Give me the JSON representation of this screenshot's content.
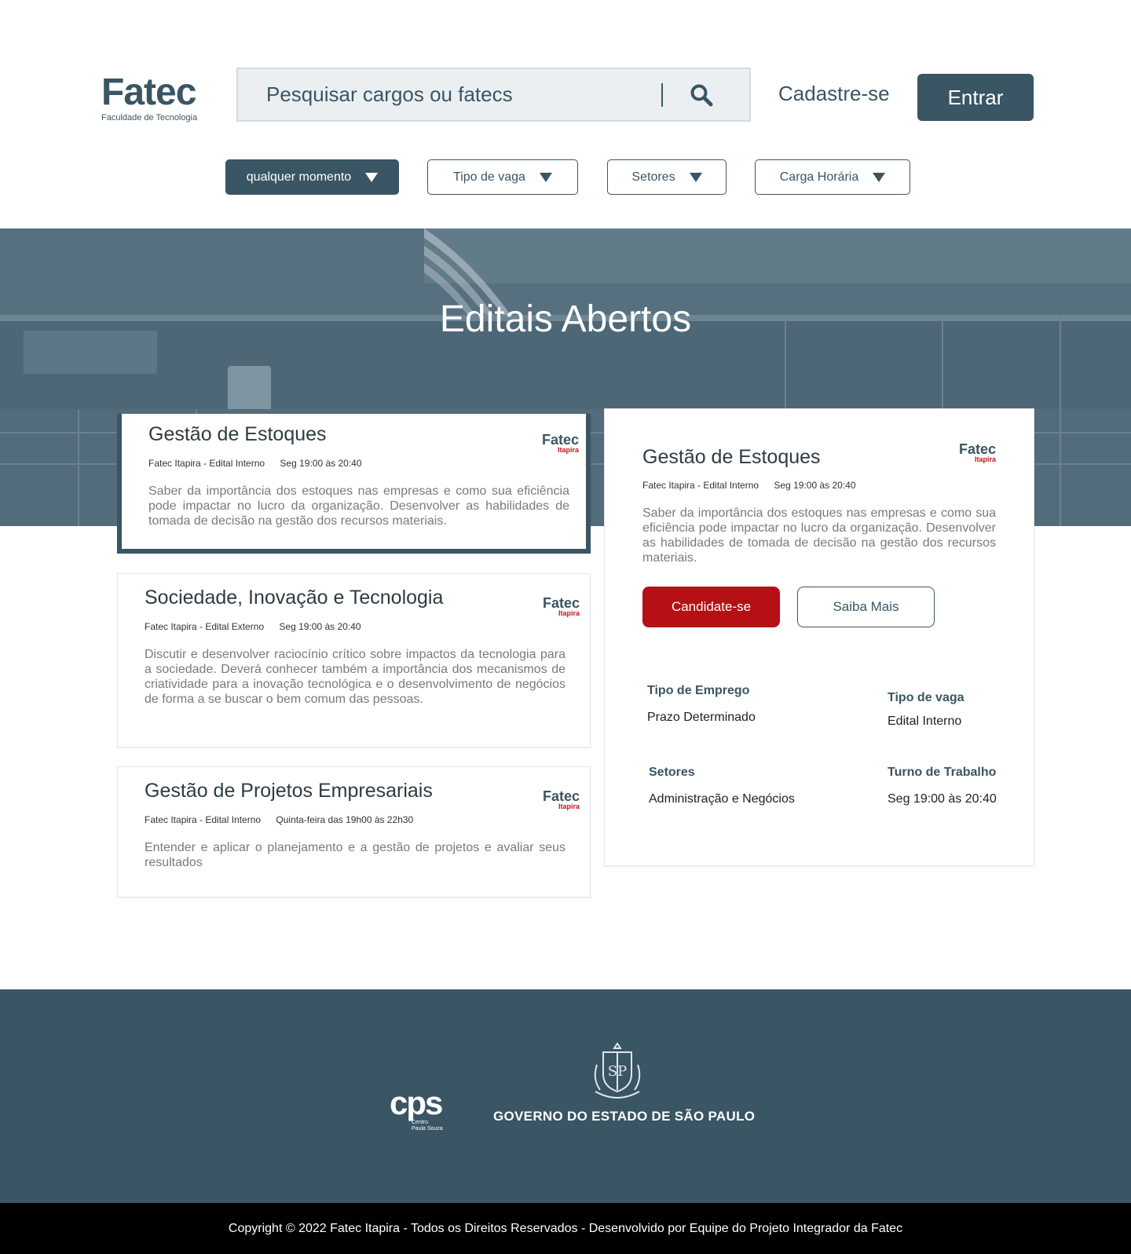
{
  "header": {
    "logo_title": "Fatec",
    "logo_subtitle": "Faculdade de Tecnologia",
    "search_placeholder": "Pesquisar cargos ou fatecs",
    "signup_label": "Cadastre-se",
    "login_label": "Entrar"
  },
  "filters": [
    {
      "label": "qualquer momento",
      "active": true
    },
    {
      "label": "Tipo de vaga",
      "active": false
    },
    {
      "label": "Setores",
      "active": false
    },
    {
      "label": "Carga Horária",
      "active": false
    }
  ],
  "hero": {
    "title": "Editais Abertos"
  },
  "card_logo": {
    "title": "Fatec",
    "subtitle": "Itapira"
  },
  "listings": [
    {
      "title": "Gestão de Estoques",
      "meta_left": "Fatec Itapira - Edital Interno",
      "meta_right": "Seg 19:00 às 20:40",
      "description": "Saber da importância dos estoques nas empresas e como sua eficiência pode impactar no lucro da organização. Desenvolver as habilidades de tomada de decisão na gestão dos recursos materiais."
    },
    {
      "title": "Sociedade, Inovação e Tecnologia",
      "meta_left": "Fatec Itapira - Edital Externo",
      "meta_right": "Seg 19:00 às 20:40",
      "description": "Discutir e desenvolver raciocínio crítico sobre impactos da tecnologia para a sociedade. Deverá conhecer também a importância dos mecanismos de criatividade para a inovação tecnológica e o desenvolvimento de negócios de forma a se buscar o bem comum das pessoas."
    },
    {
      "title": "Gestão de Projetos Empresariais",
      "meta_left": "Fatec Itapira - Edital Interno",
      "meta_right": "Quinta-feira das 19h00 às 22h30",
      "description": "Entender e aplicar o planejamento e a gestão de projetos e avaliar seus resultados"
    }
  ],
  "detail": {
    "title": "Gestão de Estoques",
    "meta_left": "Fatec Itapira - Edital Interno",
    "meta_right": "Seg 19:00 às 20:40",
    "description": "Saber da importância dos estoques nas empresas e como sua eficiência pode impactar no lucro da organização. Desenvolver as habilidades de tomada de decisão na gestão dos recursos materiais.",
    "apply_label": "Candidate-se",
    "more_label": "Saiba Mais",
    "fields": {
      "employment_type_label": "Tipo de Emprego",
      "employment_type_value": "Prazo Determinado",
      "job_type_label": "Tipo de vaga",
      "job_type_value": "Edital Interno",
      "sectors_label": "Setores",
      "sectors_value": "Administração e Negócios",
      "shift_label": "Turno de Trabalho",
      "shift_value": "Seg 19:00 às 20:40"
    }
  },
  "footer": {
    "cps_logo": "cps",
    "cps_caption_1": "Centro",
    "cps_caption_2": "Paula Souza",
    "gov_title": "GOVERNO DO ESTADO DE SÃO PAULO",
    "copyright": "Copyright © 2022 Fatec Itapira - Todos os Direitos Reservados - Desenvolvido por Equipe do Projeto Integrador da Fatec"
  },
  "colors": {
    "primary": "#3a5564",
    "accent_red": "#b60f16",
    "search_bg": "#eceff2"
  }
}
